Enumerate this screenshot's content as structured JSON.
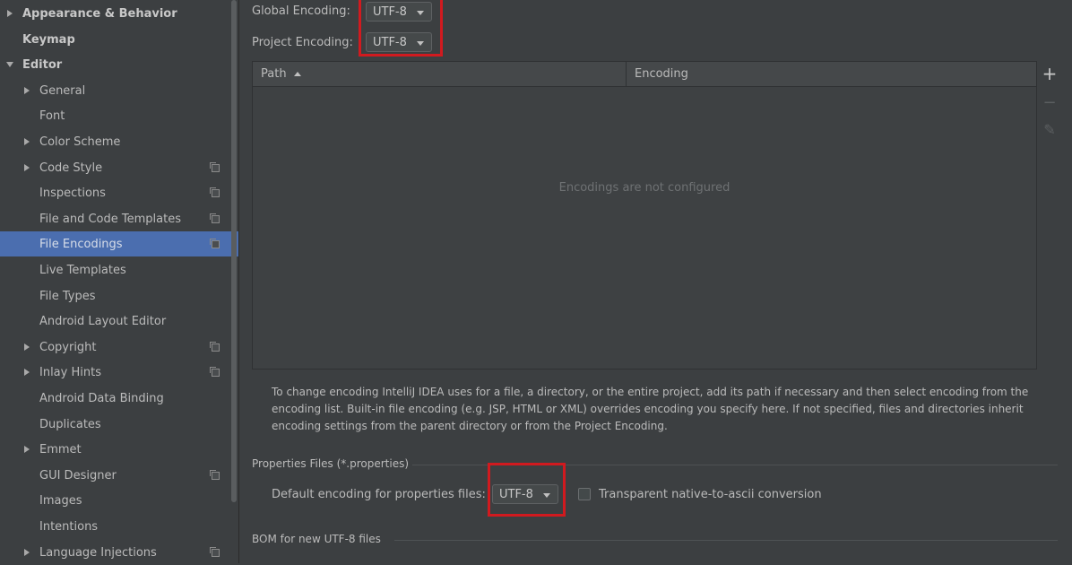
{
  "sidebar": {
    "items": [
      {
        "label": "Appearance & Behavior",
        "arrow": "right",
        "indent": 0,
        "bold": true
      },
      {
        "label": "Keymap",
        "arrow": "",
        "indent": 0,
        "bold": true
      },
      {
        "label": "Editor",
        "arrow": "down",
        "indent": 0,
        "bold": true
      },
      {
        "label": "General",
        "arrow": "right",
        "indent": 1
      },
      {
        "label": "Font",
        "arrow": "",
        "indent": 1
      },
      {
        "label": "Color Scheme",
        "arrow": "right",
        "indent": 1
      },
      {
        "label": "Code Style",
        "arrow": "right",
        "indent": 1,
        "copy": true
      },
      {
        "label": "Inspections",
        "arrow": "",
        "indent": 1,
        "copy": true
      },
      {
        "label": "File and Code Templates",
        "arrow": "",
        "indent": 1,
        "copy": true
      },
      {
        "label": "File Encodings",
        "arrow": "",
        "indent": 1,
        "copy": true,
        "selected": true
      },
      {
        "label": "Live Templates",
        "arrow": "",
        "indent": 1
      },
      {
        "label": "File Types",
        "arrow": "",
        "indent": 1
      },
      {
        "label": "Android Layout Editor",
        "arrow": "",
        "indent": 1
      },
      {
        "label": "Copyright",
        "arrow": "right",
        "indent": 1,
        "copy": true
      },
      {
        "label": "Inlay Hints",
        "arrow": "right",
        "indent": 1,
        "copy": true
      },
      {
        "label": "Android Data Binding",
        "arrow": "",
        "indent": 1
      },
      {
        "label": "Duplicates",
        "arrow": "",
        "indent": 1
      },
      {
        "label": "Emmet",
        "arrow": "right",
        "indent": 1
      },
      {
        "label": "GUI Designer",
        "arrow": "",
        "indent": 1,
        "copy": true
      },
      {
        "label": "Images",
        "arrow": "",
        "indent": 1
      },
      {
        "label": "Intentions",
        "arrow": "",
        "indent": 1
      },
      {
        "label": "Language Injections",
        "arrow": "right",
        "indent": 1,
        "copy": true
      }
    ]
  },
  "encoding": {
    "global_label": "Global Encoding:",
    "global_value": "UTF-8",
    "project_label": "Project Encoding:",
    "project_value": "UTF-8"
  },
  "table": {
    "col_path": "Path",
    "col_encoding": "Encoding",
    "empty_text": "Encodings are not configured",
    "tools": {
      "add": "+",
      "remove": "−",
      "edit": "✎"
    }
  },
  "help_text": "To change encoding IntelliJ IDEA uses for a file, a directory, or the entire project, add its path if necessary and then select encoding from the encoding list. Built-in file encoding (e.g. JSP, HTML or XML) overrides encoding you specify here. If not specified, files and directories inherit encoding settings from the parent directory or from the Project Encoding.",
  "properties": {
    "section_title": "Properties Files (*.properties)",
    "default_label": "Default encoding for properties files:",
    "default_value": "UTF-8",
    "transparent_label": "Transparent native-to-ascii conversion",
    "transparent_checked": false
  },
  "bom": {
    "section_title": "BOM for new UTF-8 files"
  },
  "colors": {
    "highlight": "#d11a1f",
    "selection": "#4b6eaf",
    "background": "#3c3f41"
  }
}
